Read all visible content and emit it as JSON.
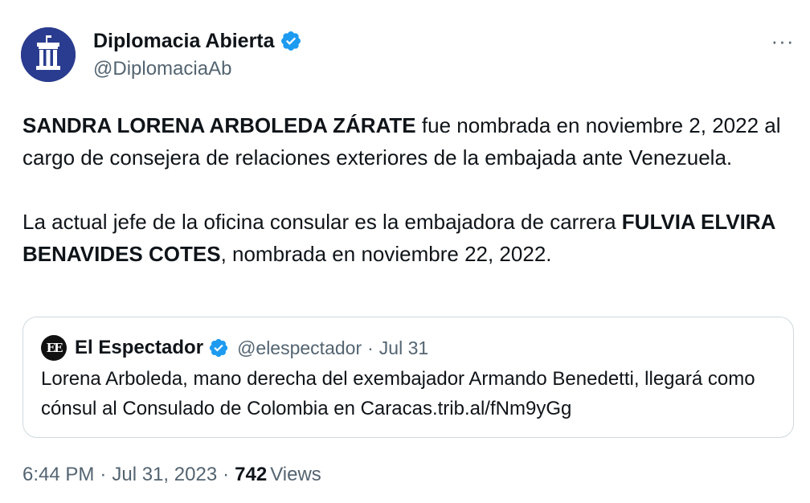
{
  "author": {
    "name": "Diplomacia Abierta",
    "handle": "@DiplomaciaAb",
    "verified": true
  },
  "more_label": "···",
  "tweet": {
    "paragraph1": {
      "bold": "SANDRA LORENA ARBOLEDA ZÁRATE",
      "text": " fue nombrada en noviembre 2, 2022 al cargo de consejera de relaciones exteriores de la embajada ante Venezuela."
    },
    "paragraph2": {
      "text_before": "La actual jefe de la oficina consular es la embajadora de carrera ",
      "bold": "FULVIA ELVIRA BENAVIDES COTES",
      "text_after": ", nombrada en noviembre 22, 2022."
    }
  },
  "quote": {
    "avatar_text": "EE",
    "name": "El Espectador",
    "handle": "@elespectador",
    "dot": "·",
    "date": "Jul 31",
    "text": "Lorena Arboleda, mano derecha del exembajador Armando Benedetti, llegará como cónsul al Consulado de Colombia en Caracas.trib.al/fNm9yGg"
  },
  "meta": {
    "time": "6:44 PM",
    "date": "Jul 31, 2023",
    "separator": "·",
    "views_count": "742",
    "views_label": "Views"
  },
  "colors": {
    "verified": "#1d9bf0",
    "secondary_text": "#536471",
    "avatar_bg": "#2a3c8f",
    "border": "#cfd9de"
  }
}
